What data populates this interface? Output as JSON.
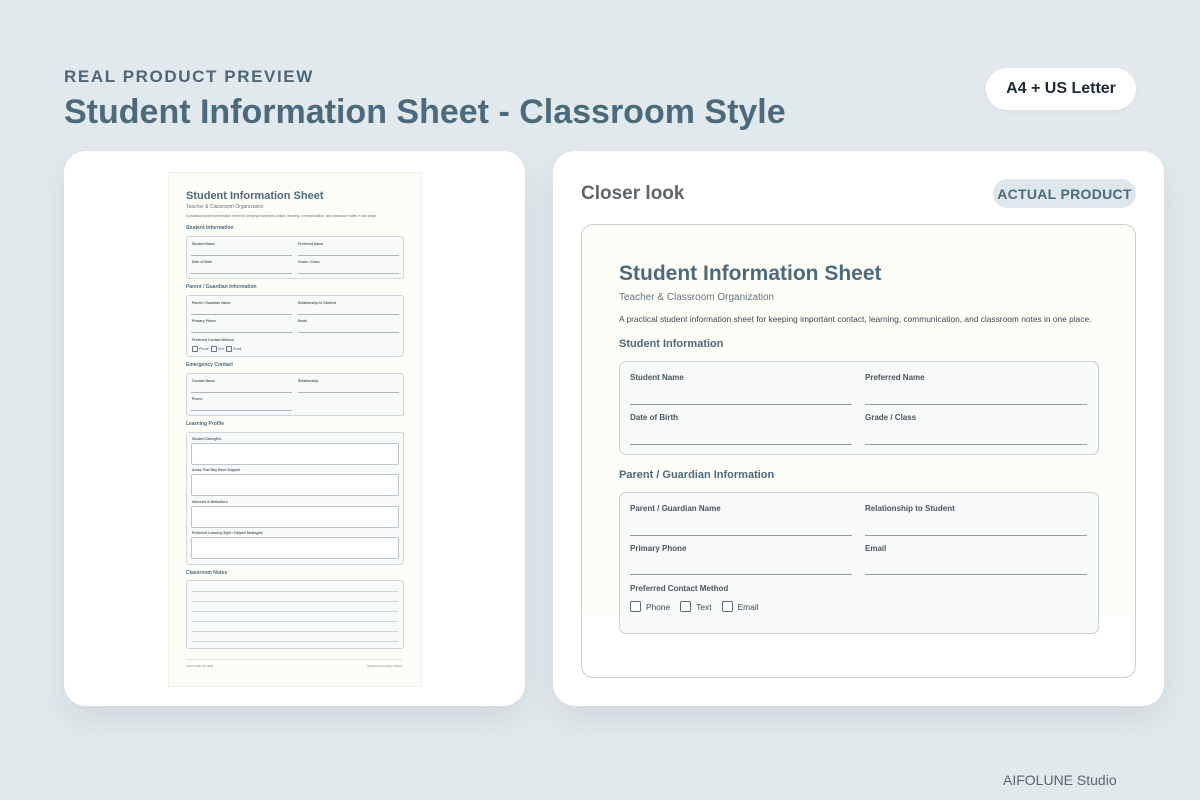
{
  "header": {
    "eyebrow": "REAL PRODUCT PREVIEW",
    "title": "Student Information Sheet - Classroom Style",
    "format_badge": "A4 + US Letter"
  },
  "closer": {
    "title": "Closer look",
    "badge": "ACTUAL PRODUCT"
  },
  "sheet": {
    "title": "Student Information Sheet",
    "subtitle": "Teacher & Classroom Organization",
    "description": "A practical student information sheet for keeping important contact, learning, communication, and classroom notes in one place.",
    "student_section": "Student Information",
    "student_fields": [
      "Student Name",
      "Preferred Name",
      "Date of Birth",
      "Grade / Class"
    ],
    "parent_section": "Parent / Guardian Information",
    "parent_fields": [
      "Parent / Guardian Name",
      "Relationship to Student",
      "Primary Phone",
      "Email"
    ],
    "contact_method_label": "Preferred Contact Method",
    "contact_options": [
      "Phone",
      "Text",
      "Email"
    ],
    "emergency_section": "Emergency Contact",
    "emergency_fields": [
      "Contact Name",
      "Relationship",
      "Phone"
    ],
    "learning_section": "Learning Profile",
    "learning_fields": [
      "Student Strengths",
      "Areas That May Need Support",
      "Interests & Motivators",
      "Preferred Learning Style / Helpful Strategies"
    ],
    "notes_section": "Classroom Notes",
    "footer_left": "AIFOLUNE STUDIO",
    "footer_right": "Student Information Sheet"
  },
  "footer": {
    "studio": "AIFOLUNE Studio"
  },
  "colors": {
    "background": "#e2e9ed",
    "heading": "#4d6a7d",
    "page": "#fdfdf8"
  }
}
